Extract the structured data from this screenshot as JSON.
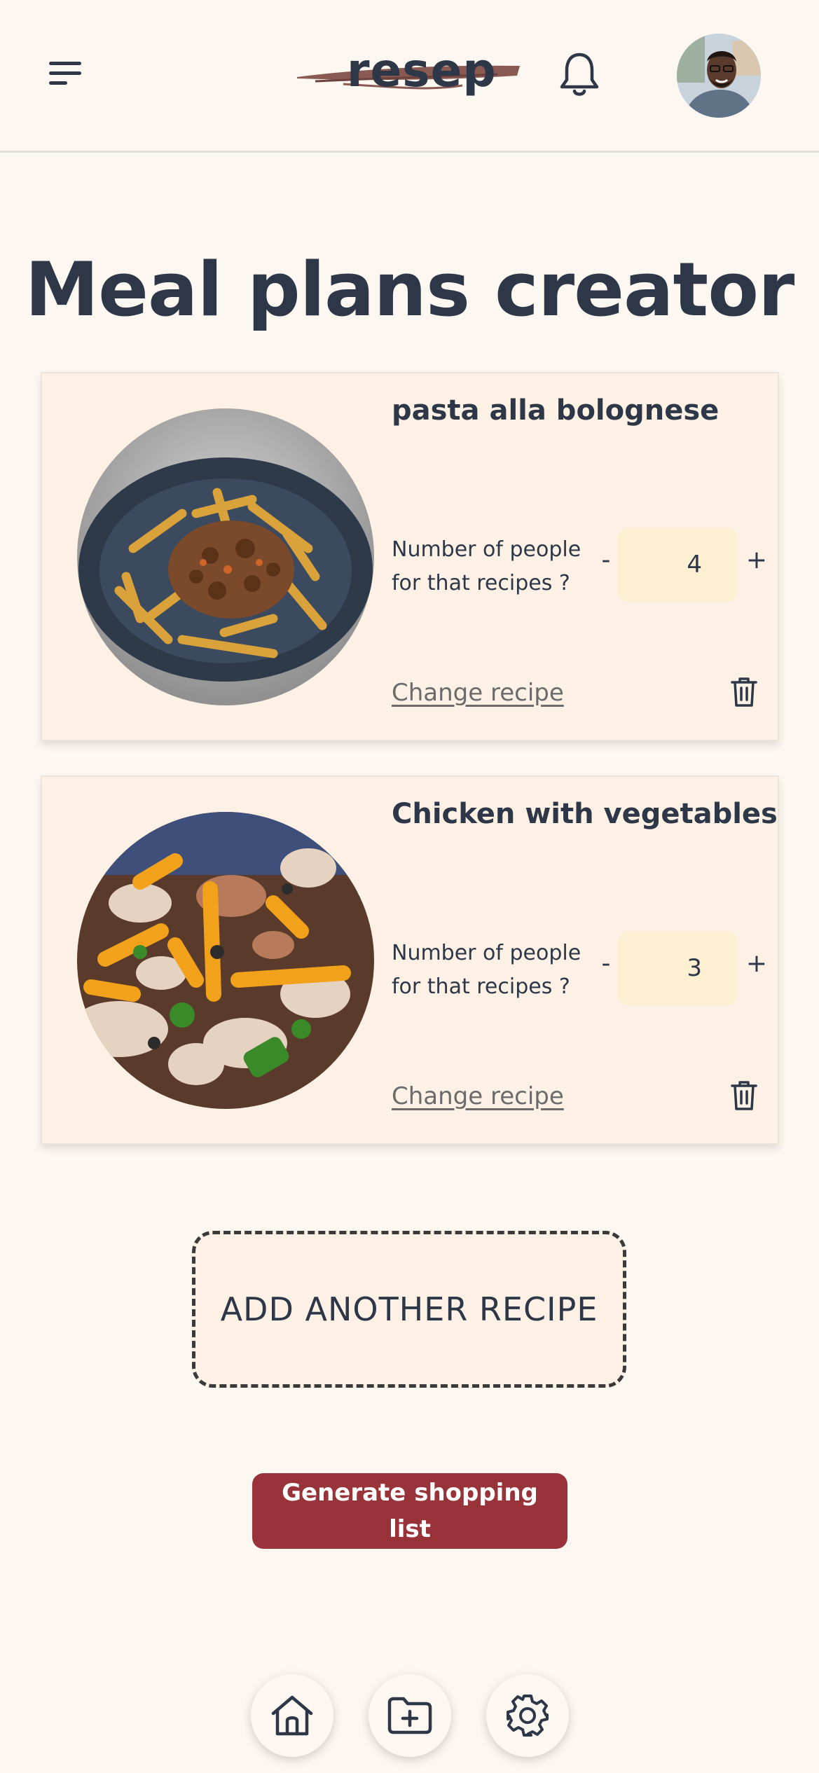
{
  "header": {
    "logo_text": "resep",
    "menu_icon": "menu-icon",
    "notification_icon": "bell-icon",
    "avatar_icon": "user-avatar"
  },
  "page": {
    "title": "Meal plans creator"
  },
  "recipes": [
    {
      "name": "pasta alla bolognese",
      "people_label": "Number of people for that recipes ?",
      "people_count": "4",
      "minus_label": "-",
      "plus_label": "+",
      "change_label": "Change recipe",
      "delete_icon": "trash-icon",
      "image": "pasta-bolognese-photo"
    },
    {
      "name": "Chicken with vegetables",
      "people_label": "Number of people for that recipes ?",
      "people_count": "3",
      "minus_label": "-",
      "plus_label": "+",
      "change_label": "Change recipe",
      "delete_icon": "trash-icon",
      "image": "chicken-vegetables-photo"
    }
  ],
  "actions": {
    "add_recipe_label": "ADD ANOTHER RECIPE",
    "generate_label": "Generate shopping list"
  },
  "bottom_nav": {
    "items": [
      "home-icon",
      "folder-plus-icon",
      "gear-icon"
    ]
  },
  "colors": {
    "background": "#fdf7f1",
    "card": "#fdf1e5",
    "accent": "#99333a",
    "input": "#fdf0d2",
    "text": "#2d3748"
  }
}
